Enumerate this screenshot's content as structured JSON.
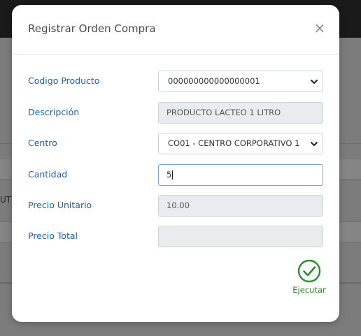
{
  "background": {
    "partial_cell_text": "UT"
  },
  "modal": {
    "title": "Registrar Orden Compra",
    "close_symbol": "×",
    "fields": {
      "codigo_producto": {
        "label": "Codigo Producto",
        "value": "000000000000000001"
      },
      "descripcion": {
        "label": "Descripción",
        "value": "PRODUCTO LACTEO 1 LITRO"
      },
      "centro": {
        "label": "Centro",
        "value": "CO01 - CENTRO CORPORATIVO 1"
      },
      "cantidad": {
        "label": "Cantidad",
        "value": "5"
      },
      "precio_unitario": {
        "label": "Precio Unitario",
        "value": "10.00"
      },
      "precio_total": {
        "label": "Precio Total",
        "value": ""
      }
    },
    "execute_label": "Ejecutar"
  },
  "colors": {
    "label_blue": "#1f5fa8",
    "execute_green": "#2e8b2e",
    "readonly_bg": "#e9ecef"
  },
  "icons": {
    "close": "close-icon",
    "select": "chevron-down-icon",
    "execute": "check-circle-icon"
  }
}
